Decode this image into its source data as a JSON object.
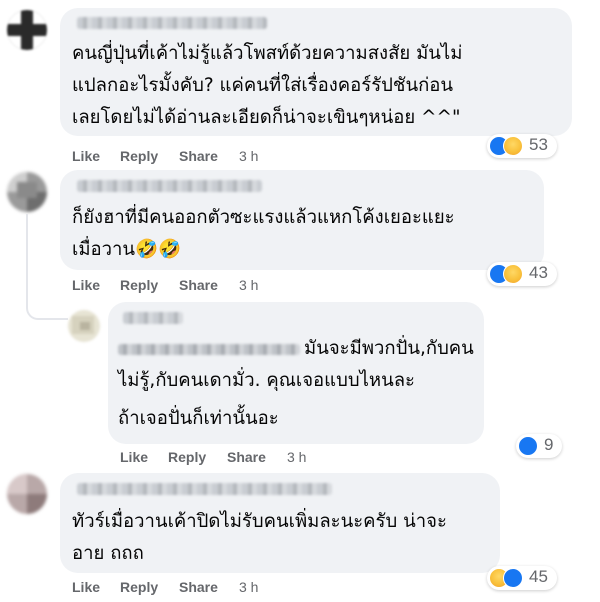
{
  "comments": [
    {
      "lines": [
        "คนญี่ปุ่นที่เค้าไม่รู้แล้วโพสท์ด้วยความสงสัย มันไม่",
        "แปลกอะไรมั้งคับ? แค่คนที่ใส่เรื่องคอร์รัปชันก่อน",
        "เลยโดยไม่ได้อ่านละเอียดก็น่าจะเขินๆหน่อย ^^\""
      ],
      "actions": {
        "like": "Like",
        "reply": "Reply",
        "share": "Share",
        "time": "3 h"
      },
      "reactions": {
        "icons": [
          "like-icon",
          "haha-icon"
        ],
        "count": "53"
      }
    },
    {
      "lines": [
        "ก็ยังฮาที่มีคนออกตัวซะแรงแล้วแหกโค้งเยอะแยะ",
        "เมื่อวาน🤣🤣"
      ],
      "actions": {
        "like": "Like",
        "reply": "Reply",
        "share": "Share",
        "time": "3 h"
      },
      "reactions": {
        "icons": [
          "like-icon",
          "haha-icon"
        ],
        "count": "43"
      }
    },
    {
      "lines": [
        "มันจะมีพวกปั่น,กับคน",
        "ไม่รู้,กับคนเดามั่ว. คุณเจอแบบไหนละ",
        "ถ้าเจอปั่นก็เท่านั้นอะ"
      ],
      "actions": {
        "like": "Like",
        "reply": "Reply",
        "share": "Share",
        "time": "3 h"
      },
      "reactions": {
        "icons": [
          "like-icon"
        ],
        "count": "9"
      }
    },
    {
      "lines": [
        "ทัวร์เมื่อวานเค้าปิดไม่รับคนเพิ่มละนะครับ น่าจะ",
        "อาย ถถถ"
      ],
      "actions": {
        "like": "Like",
        "reply": "Reply",
        "share": "Share",
        "time": "3 h"
      },
      "reactions": {
        "icons": [
          "haha-icon",
          "like-icon"
        ],
        "count": "45"
      }
    }
  ],
  "colors": {
    "bubble": "#f0f2f5",
    "meta_text": "#65676b",
    "like_blue": "#1877f2",
    "haha_yellow": "#f9c13b"
  }
}
